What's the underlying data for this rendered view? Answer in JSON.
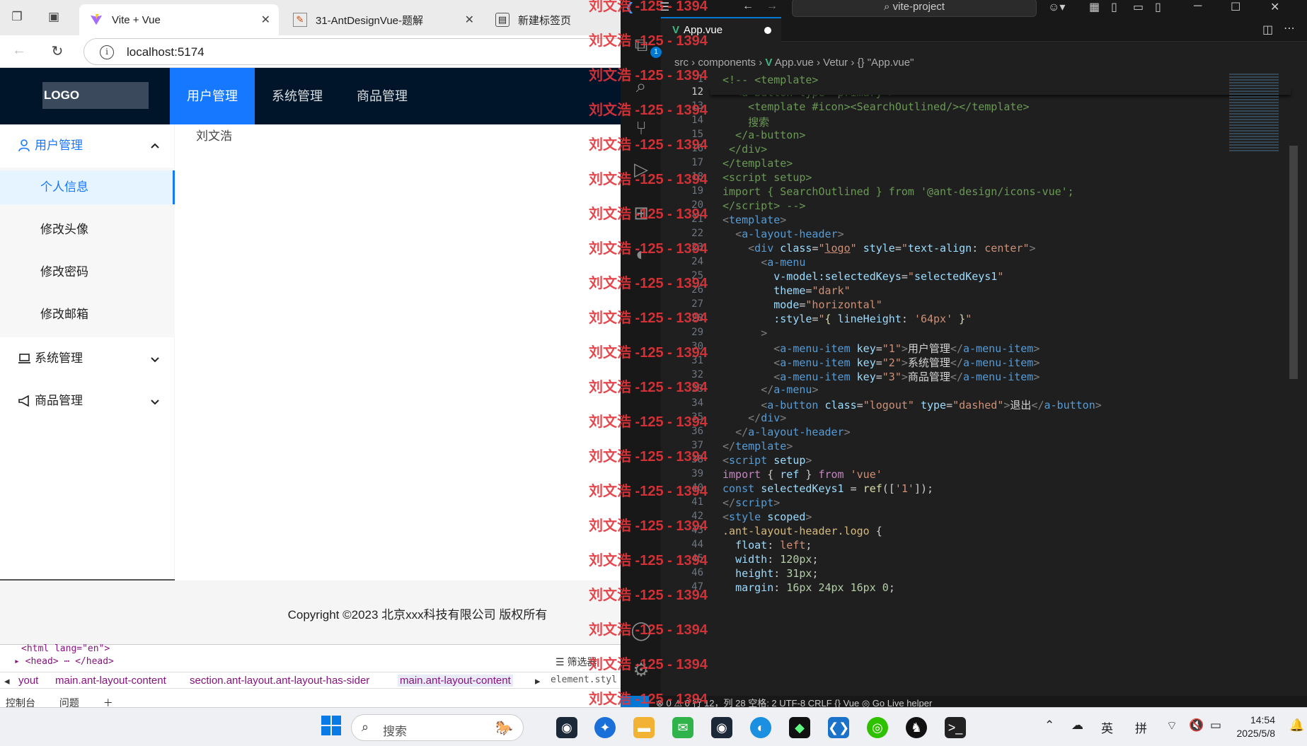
{
  "browser": {
    "tabs": [
      {
        "title": "Vite + Vue",
        "active": true
      },
      {
        "title": "31-AntDesignVue-题解",
        "active": false
      },
      {
        "title": "新建标签页",
        "active": false
      }
    ],
    "url": "localhost:5174"
  },
  "app": {
    "logo": "LOGO",
    "top_menu": [
      "用户管理",
      "系统管理",
      "商品管理"
    ],
    "sider": {
      "user_mgmt": "用户管理",
      "items": [
        "个人信息",
        "修改头像",
        "修改密码",
        "修改邮箱"
      ],
      "system_mgmt": "系统管理",
      "product_mgmt": "商品管理"
    },
    "content": "刘文浩",
    "footer": "Copyright ©2023 北京xxx科技有限公司 版权所有"
  },
  "devtools": {
    "html_line": "<html lang=\"en\">",
    "head_line": "<head> ⋯ </head>",
    "filter": "筛选器",
    "crumbs": [
      "yout",
      "main.ant-layout-content",
      "section.ant-layout.ant-layout-has-sider",
      "main.ant-layout-content"
    ],
    "styles_label": "element.styl",
    "bottom_tabs": [
      "控制台",
      "问题"
    ]
  },
  "vscode": {
    "search": "vite-project",
    "tab": "App.vue",
    "breadcrumb": {
      "src": "src",
      "components": "components",
      "file": "App.vue",
      "vetur": "Vetur",
      "scope": "{} \"App.vue\""
    },
    "line_numbers": [
      "1",
      "12",
      "13",
      "14",
      "15",
      "16",
      "17",
      "18",
      "19",
      "20",
      "21",
      "22",
      "23",
      "24",
      "25",
      "26",
      "27",
      "28",
      "29",
      "30",
      "31",
      "32",
      "33",
      "34",
      "35",
      "36",
      "37",
      "38",
      "39",
      "40",
      "41",
      "42",
      "43",
      "44",
      "45",
      "46",
      "47"
    ],
    "status": "⊗ 0 ⚠ 0     行 12，列 28  空格: 2  UTF-8  CRLF  {} Vue  ◎ Go Live  helper"
  },
  "watermark": "刘文浩 -125 - 1394",
  "taskbar": {
    "search": "搜索",
    "ime1": "英",
    "ime2": "拼",
    "time": "14:54",
    "date": "2025/5/8"
  }
}
